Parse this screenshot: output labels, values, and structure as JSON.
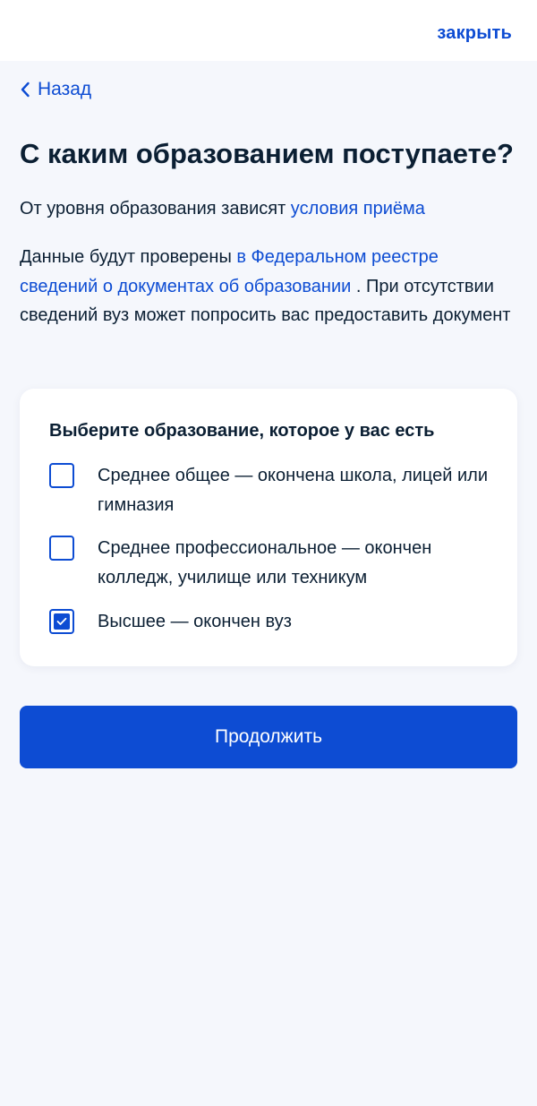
{
  "header": {
    "close_label": "закрыть"
  },
  "nav": {
    "back_label": "Назад"
  },
  "page": {
    "title": "С каким образованием поступаете?",
    "intro_text": "От уровня образования зависят ",
    "intro_link": "условия приёма",
    "info_text_before": "Данные будут проверены ",
    "info_link": "в Федеральном реестре сведений о документах об образовании",
    "info_text_after": " . При отсутствии сведений вуз может попросить вас предоставить документ"
  },
  "education_form": {
    "title": "Выберите образование, которое у вас есть",
    "options": [
      {
        "label": "Среднее общее — окончена школа, лицей или гимназия",
        "checked": false
      },
      {
        "label": "Среднее профессиональное — окончен колледж, училище или техникум",
        "checked": false
      },
      {
        "label": "Высшее — окончен вуз",
        "checked": true
      }
    ]
  },
  "actions": {
    "continue_label": "Продолжить"
  },
  "colors": {
    "accent": "#0d4cd3",
    "text": "#0b1f33",
    "background": "#f5f7fc"
  }
}
